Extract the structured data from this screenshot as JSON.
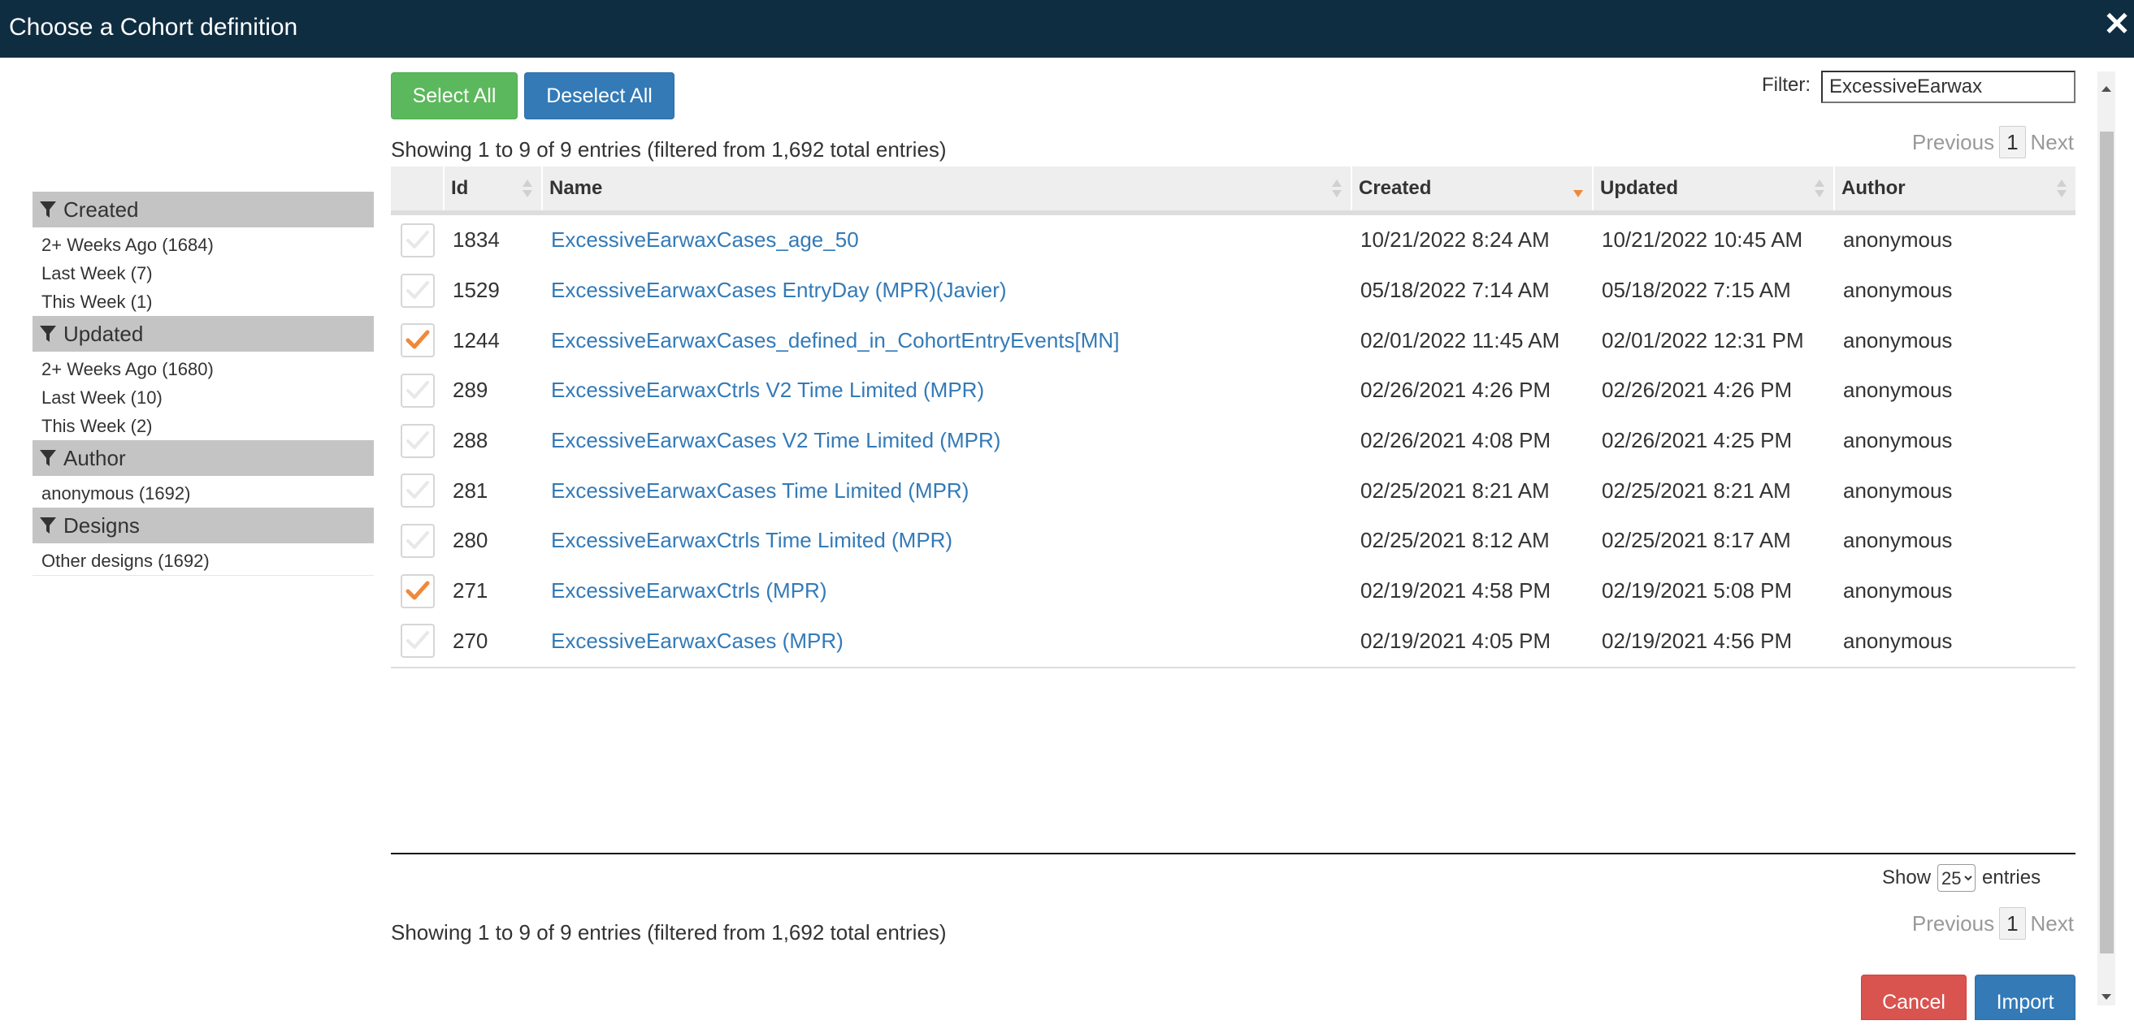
{
  "dialog": {
    "title": "Choose a Cohort definition",
    "close_glyph": "✕"
  },
  "facets": [
    {
      "title": "Created",
      "icon": "filter-icon",
      "items": [
        "2+ Weeks Ago (1684)",
        "Last Week (7)",
        "This Week (1)"
      ]
    },
    {
      "title": "Updated",
      "icon": "filter-icon",
      "items": [
        "2+ Weeks Ago (1680)",
        "Last Week (10)",
        "This Week (2)"
      ]
    },
    {
      "title": "Author",
      "icon": "filter-icon",
      "items": [
        "anonymous (1692)"
      ]
    },
    {
      "title": "Designs",
      "icon": "filter-icon",
      "items": [
        "Other designs (1692)"
      ]
    }
  ],
  "toolbar": {
    "select_all": "Select All",
    "deselect_all": "Deselect All",
    "filter_label": "Filter:",
    "filter_value": "ExcessiveEarwax"
  },
  "info_text": "Showing 1 to 9 of 9 entries (filtered from 1,692 total entries)",
  "pager": {
    "previous": "Previous",
    "page": "1",
    "next": "Next"
  },
  "table": {
    "columns": [
      "Id",
      "Name",
      "Created",
      "Updated",
      "Author"
    ],
    "sorted_column": "Created",
    "rows": [
      {
        "checked": false,
        "id": "1834",
        "name": "ExcessiveEarwaxCases_age_50",
        "created": "10/21/2022 8:24 AM",
        "updated": "10/21/2022 10:45 AM",
        "author": "anonymous"
      },
      {
        "checked": false,
        "id": "1529",
        "name": "ExcessiveEarwaxCases EntryDay (MPR)(Javier)",
        "created": "05/18/2022 7:14 AM",
        "updated": "05/18/2022 7:15 AM",
        "author": "anonymous"
      },
      {
        "checked": true,
        "id": "1244",
        "name": "ExcessiveEarwaxCases_defined_in_CohortEntryEvents[MN]",
        "created": "02/01/2022 11:45 AM",
        "updated": "02/01/2022 12:31 PM",
        "author": "anonymous"
      },
      {
        "checked": false,
        "id": "289",
        "name": "ExcessiveEarwaxCtrls V2 Time Limited (MPR)",
        "created": "02/26/2021 4:26 PM",
        "updated": "02/26/2021 4:26 PM",
        "author": "anonymous"
      },
      {
        "checked": false,
        "id": "288",
        "name": "ExcessiveEarwaxCases V2 Time Limited (MPR)",
        "created": "02/26/2021 4:08 PM",
        "updated": "02/26/2021 4:25 PM",
        "author": "anonymous"
      },
      {
        "checked": false,
        "id": "281",
        "name": "ExcessiveEarwaxCases Time Limited (MPR)",
        "created": "02/25/2021 8:21 AM",
        "updated": "02/25/2021 8:21 AM",
        "author": "anonymous"
      },
      {
        "checked": false,
        "id": "280",
        "name": "ExcessiveEarwaxCtrls Time Limited (MPR)",
        "created": "02/25/2021 8:12 AM",
        "updated": "02/25/2021 8:17 AM",
        "author": "anonymous"
      },
      {
        "checked": true,
        "id": "271",
        "name": "ExcessiveEarwaxCtrls (MPR)",
        "created": "02/19/2021 4:58 PM",
        "updated": "02/19/2021 5:08 PM",
        "author": "anonymous"
      },
      {
        "checked": false,
        "id": "270",
        "name": "ExcessiveEarwaxCases (MPR)",
        "created": "02/19/2021 4:05 PM",
        "updated": "02/19/2021 4:56 PM",
        "author": "anonymous"
      }
    ]
  },
  "show_entries": {
    "prefix": "Show",
    "value": "25",
    "options": [
      "25"
    ],
    "suffix": "entries"
  },
  "footer": {
    "cancel": "Cancel",
    "import": "Import"
  },
  "colors": {
    "title_bar": "#0f2d41",
    "link": "#337ab7",
    "check": "#f0883a",
    "green": "#5cb85c",
    "blue": "#337ab7",
    "red": "#d9534f"
  }
}
